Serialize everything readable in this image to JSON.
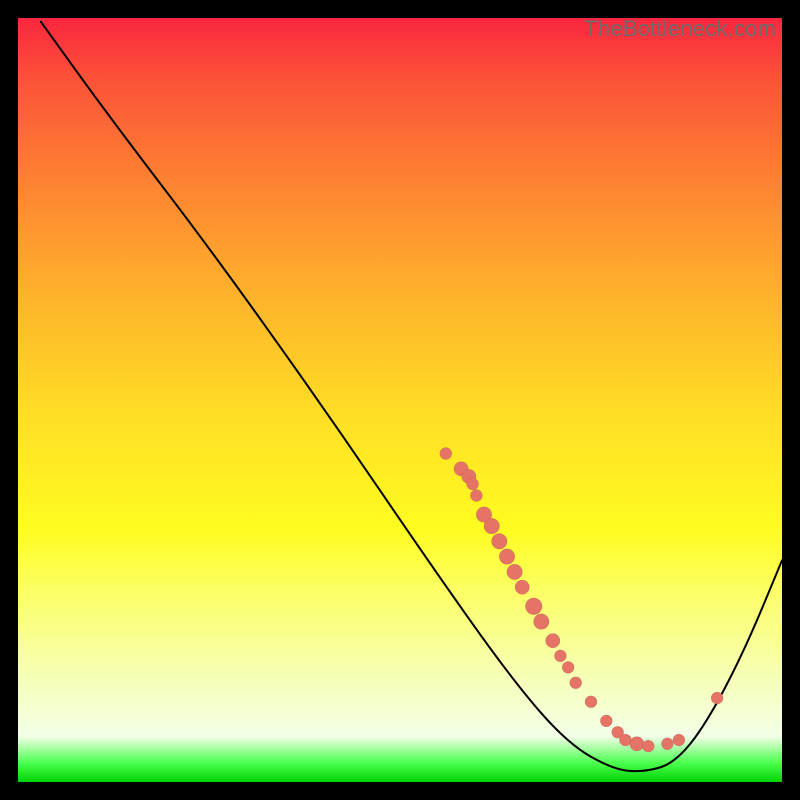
{
  "watermark": "TheBottleneck.com",
  "chart_data": {
    "type": "line",
    "title": "",
    "xlabel": "",
    "ylabel": "",
    "xlim": [
      0,
      100
    ],
    "ylim": [
      0,
      100
    ],
    "grid": false,
    "curve": [
      {
        "x": 3.0,
        "y": 99.5
      },
      {
        "x": 12.0,
        "y": 87.0
      },
      {
        "x": 25.0,
        "y": 70.0
      },
      {
        "x": 40.0,
        "y": 49.0
      },
      {
        "x": 55.0,
        "y": 27.0
      },
      {
        "x": 65.0,
        "y": 13.0
      },
      {
        "x": 72.0,
        "y": 5.0
      },
      {
        "x": 78.0,
        "y": 1.6
      },
      {
        "x": 82.0,
        "y": 1.3
      },
      {
        "x": 86.0,
        "y": 2.5
      },
      {
        "x": 90.0,
        "y": 7.5
      },
      {
        "x": 95.0,
        "y": 17.0
      },
      {
        "x": 100.0,
        "y": 29.0
      }
    ],
    "dots": [
      {
        "x": 56.0,
        "y": 43.0,
        "r": 1.0
      },
      {
        "x": 58.0,
        "y": 41.0,
        "r": 1.2
      },
      {
        "x": 59.0,
        "y": 40.0,
        "r": 1.2
      },
      {
        "x": 59.5,
        "y": 39.0,
        "r": 1.0
      },
      {
        "x": 60.0,
        "y": 37.5,
        "r": 1.0
      },
      {
        "x": 61.0,
        "y": 35.0,
        "r": 1.3
      },
      {
        "x": 62.0,
        "y": 33.5,
        "r": 1.3
      },
      {
        "x": 63.0,
        "y": 31.5,
        "r": 1.3
      },
      {
        "x": 64.0,
        "y": 29.5,
        "r": 1.3
      },
      {
        "x": 65.0,
        "y": 27.5,
        "r": 1.3
      },
      {
        "x": 66.0,
        "y": 25.5,
        "r": 1.2
      },
      {
        "x": 67.5,
        "y": 23.0,
        "r": 1.4
      },
      {
        "x": 68.5,
        "y": 21.0,
        "r": 1.3
      },
      {
        "x": 70.0,
        "y": 18.5,
        "r": 1.2
      },
      {
        "x": 71.0,
        "y": 16.5,
        "r": 1.0
      },
      {
        "x": 72.0,
        "y": 15.0,
        "r": 1.0
      },
      {
        "x": 73.0,
        "y": 13.0,
        "r": 1.0
      },
      {
        "x": 75.0,
        "y": 10.5,
        "r": 1.0
      },
      {
        "x": 77.0,
        "y": 8.0,
        "r": 1.0
      },
      {
        "x": 78.5,
        "y": 6.5,
        "r": 1.0
      },
      {
        "x": 79.5,
        "y": 5.5,
        "r": 1.0
      },
      {
        "x": 81.0,
        "y": 5.0,
        "r": 1.2
      },
      {
        "x": 82.5,
        "y": 4.7,
        "r": 1.0
      },
      {
        "x": 85.0,
        "y": 5.0,
        "r": 1.0
      },
      {
        "x": 86.5,
        "y": 5.5,
        "r": 1.0
      },
      {
        "x": 91.5,
        "y": 11.0,
        "r": 1.0
      }
    ]
  }
}
